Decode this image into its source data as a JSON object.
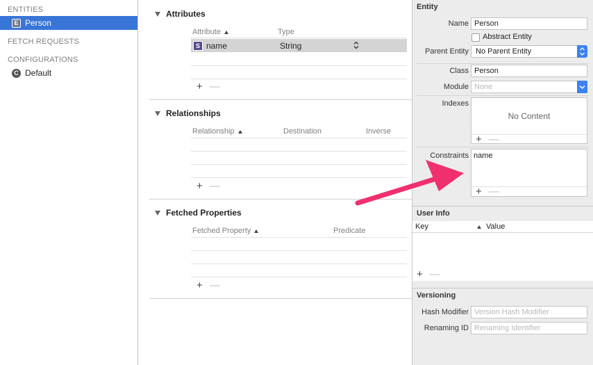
{
  "sidebar": {
    "entities_header": "ENTITIES",
    "entity_badge": "E",
    "entity_name": "Person",
    "fetch_requests_header": "FETCH REQUESTS",
    "configurations_header": "CONFIGURATIONS",
    "config_badge": "C",
    "config_name": "Default"
  },
  "editor": {
    "attributes": {
      "title": "Attributes",
      "col_attribute": "Attribute",
      "col_type": "Type",
      "row": {
        "badge": "S",
        "name": "name",
        "type": "String"
      }
    },
    "relationships": {
      "title": "Relationships",
      "col_relationship": "Relationship",
      "col_destination": "Destination",
      "col_inverse": "Inverse"
    },
    "fetched_properties": {
      "title": "Fetched Properties",
      "col_fetched_property": "Fetched Property",
      "col_predicate": "Predicate"
    },
    "plus": "+",
    "minus": "—"
  },
  "inspector": {
    "entity_title": "Entity",
    "name_label": "Name",
    "name_value": "Person",
    "abstract_label": "Abstract Entity",
    "parent_label": "Parent Entity",
    "parent_value": "No Parent Entity",
    "class_label": "Class",
    "class_value": "Person",
    "module_label": "Module",
    "module_placeholder": "None",
    "indexes_label": "Indexes",
    "indexes_empty": "No Content",
    "constraints_label": "Constraints",
    "constraints_value": "name",
    "user_info_title": "User Info",
    "key_col": "Key",
    "value_col": "Value",
    "versioning_title": "Versioning",
    "hash_label": "Hash Modifier",
    "hash_placeholder": "Version Hash Modifier",
    "renaming_label": "Renaming ID",
    "renaming_placeholder": "Renaming Identifier"
  },
  "colors": {
    "selection": "#3875d7",
    "arrow": "#f0306e",
    "select_button": "#3b82f0"
  }
}
